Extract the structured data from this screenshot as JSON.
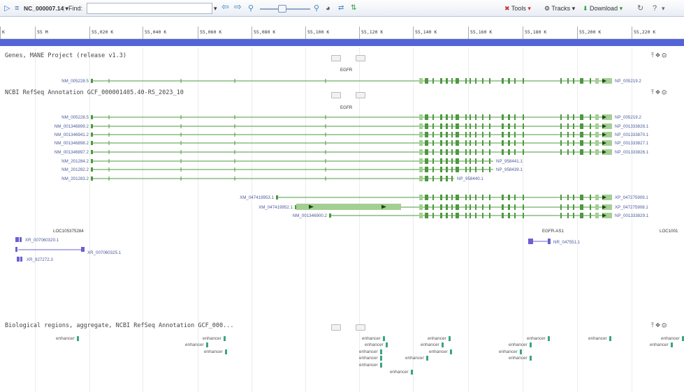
{
  "toolbar": {
    "accession": "NC_000007.14",
    "find_label": "Find:",
    "find_value": "",
    "tools_label": "Tools",
    "tracks_label": "Tracks",
    "download_label": "Download"
  },
  "ruler": {
    "labels": [
      "K",
      "55 M",
      "55,020 K",
      "55,040 K",
      "55,060 K",
      "55,080 K",
      "55,100 K",
      "55,120 K",
      "55,140 K",
      "55,160 K",
      "55,180 K",
      "55,200 K",
      "55,220 K"
    ]
  },
  "tracks": {
    "mane_title": "Genes, MANE Project (release v1.3)",
    "refseq_title": "NCBI RefSeq Annotation GCF_000001405.40-RS_2023_10",
    "bio_title": "Biological regions, aggregate, NCBI RefSeq Annotation GCF_000..."
  },
  "genes": {
    "egfr": "EGFR",
    "egfr_as1": "EGFR-AS1",
    "loc1": "LOC105375284",
    "loc2": "LOC1001"
  },
  "transcripts": {
    "mane_nm": "NM_005228.5",
    "mane_np": "NP_005219.2",
    "rows": [
      {
        "left": "NM_005228.5",
        "right": "NP_005219.2"
      },
      {
        "left": "NM_001346899.2",
        "right": "NP_001333828.1"
      },
      {
        "left": "NM_001346941.2",
        "right": "NP_001333870.1"
      },
      {
        "left": "NM_001346898.2",
        "right": "NP_001333827.1"
      },
      {
        "left": "NM_001346897.2",
        "right": "NP_001333826.1"
      },
      {
        "left": "NM_201284.2",
        "right": "NP_958441.1"
      },
      {
        "left": "NM_201282.2",
        "right": "NP_958439.1"
      },
      {
        "left": "NM_201283.2",
        "right": "NP_958440.1"
      },
      {
        "left": "XM_047419953.1",
        "right": "XP_047275909.1"
      },
      {
        "left": "XM_047419952.1",
        "right": "XP_047275908.1"
      },
      {
        "left": "NM_001346900.2",
        "right": "NP_001333829.1"
      }
    ],
    "lnc1": "XR_007060320.1",
    "lnc2": "XR_007060325.1",
    "lnc3": "XR_927272.3",
    "as1": "NR_047551.1"
  },
  "enhancer_label": "enhancer",
  "colors": {
    "exon": "#4c9a3f",
    "utr": "#a4cf93",
    "intron": "#4c9a3f",
    "lnc": "#6c5fd0",
    "enhancer": "#3aa67c",
    "ruler_bar": "#5264d8"
  }
}
